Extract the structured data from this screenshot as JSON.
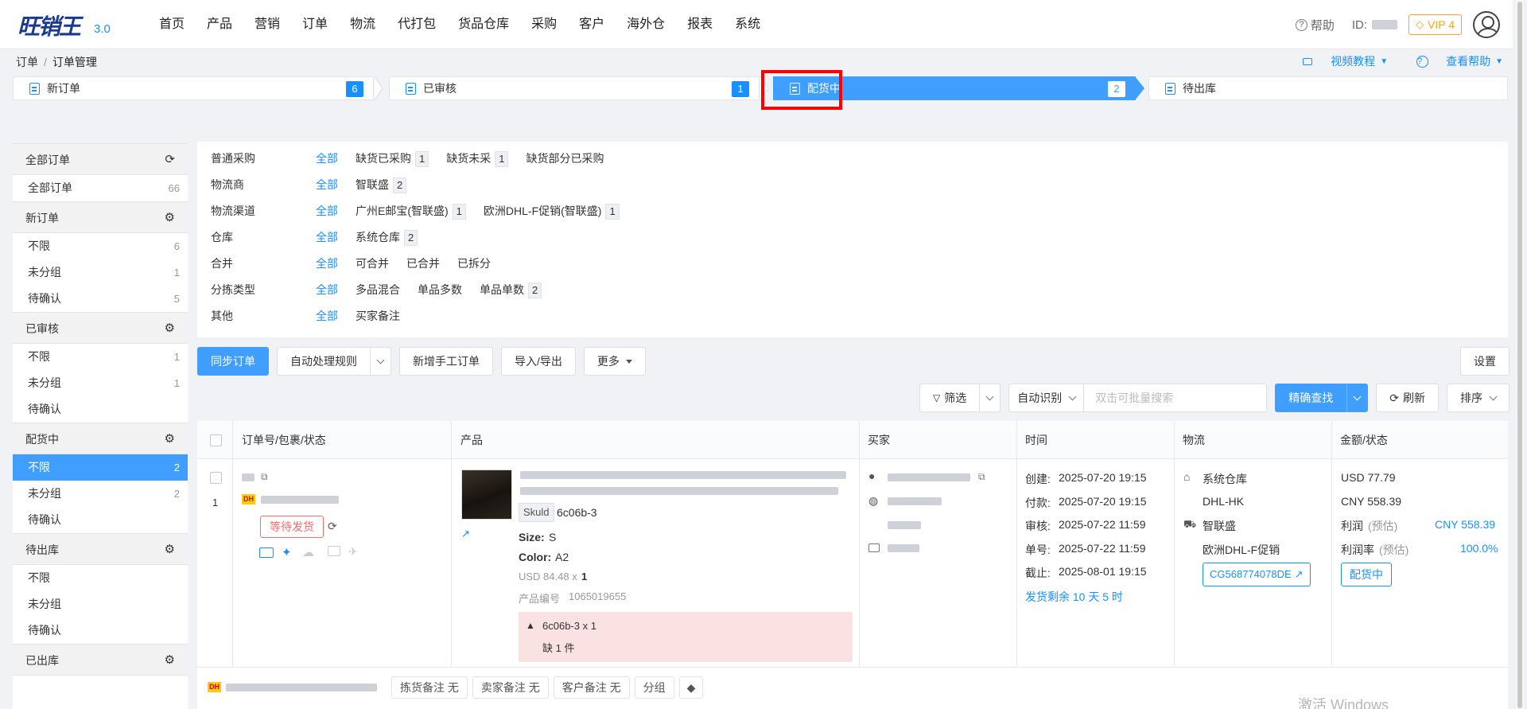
{
  "app": {
    "logo_text": "旺销王",
    "version": "3.0"
  },
  "nav": [
    "首页",
    "产品",
    "营销",
    "订单",
    "物流",
    "代打包",
    "货品仓库",
    "采购",
    "客户",
    "海外仓",
    "报表",
    "系统"
  ],
  "topright": {
    "help": "帮助",
    "id_label": "ID:",
    "vip": "VIP 4"
  },
  "breadcrumb": [
    "订单",
    "订单管理"
  ],
  "header_links": {
    "video": "视频教程",
    "help": "查看帮助"
  },
  "steps": [
    {
      "label": "新订单",
      "count": "6"
    },
    {
      "label": "已审核",
      "count": "1"
    },
    {
      "label": "配货中",
      "count": "2",
      "active": true
    },
    {
      "label": "待出库",
      "count": ""
    }
  ],
  "sidebar": [
    {
      "title": "全部订单",
      "icon": "refresh-icon",
      "items": [
        {
          "label": "全部订单",
          "count": "66"
        }
      ]
    },
    {
      "title": "新订单",
      "icon": "gear-icon",
      "items": [
        {
          "label": "不限",
          "count": "6"
        },
        {
          "label": "未分组",
          "count": "1"
        },
        {
          "label": "待确认",
          "count": "5"
        }
      ]
    },
    {
      "title": "已审核",
      "icon": "gear-icon",
      "items": [
        {
          "label": "不限",
          "count": "1"
        },
        {
          "label": "未分组",
          "count": "1"
        },
        {
          "label": "待确认",
          "count": ""
        }
      ]
    },
    {
      "title": "配货中",
      "icon": "gear-icon",
      "items": [
        {
          "label": "不限",
          "count": "2",
          "selected": true
        },
        {
          "label": "未分组",
          "count": "2"
        },
        {
          "label": "待确认",
          "count": ""
        }
      ]
    },
    {
      "title": "待出库",
      "icon": "gear-icon",
      "items": [
        {
          "label": "不限",
          "count": ""
        },
        {
          "label": "未分组",
          "count": ""
        },
        {
          "label": "待确认",
          "count": ""
        }
      ]
    },
    {
      "title": "已出库",
      "icon": "gear-icon",
      "items": []
    }
  ],
  "filters": [
    {
      "label": "普通采购",
      "all": "全部",
      "options": [
        {
          "text": "缺货已采购",
          "count": "1"
        },
        {
          "text": "缺货未采",
          "count": "1"
        },
        {
          "text": "缺货部分已采购",
          "count": ""
        }
      ]
    },
    {
      "label": "物流商",
      "all": "全部",
      "options": [
        {
          "text": "智联盛",
          "count": "2"
        }
      ]
    },
    {
      "label": "物流渠道",
      "all": "全部",
      "options": [
        {
          "text": "广州E邮宝(智联盛)",
          "count": "1"
        },
        {
          "text": "欧洲DHL-F促销(智联盛)",
          "count": "1"
        }
      ]
    },
    {
      "label": "仓库",
      "all": "全部",
      "options": [
        {
          "text": "系统仓库",
          "count": "2"
        }
      ]
    },
    {
      "label": "合并",
      "all": "全部",
      "options": [
        {
          "text": "可合并",
          "count": ""
        },
        {
          "text": "已合并",
          "count": ""
        },
        {
          "text": "已拆分",
          "count": ""
        }
      ]
    },
    {
      "label": "分拣类型",
      "all": "全部",
      "options": [
        {
          "text": "多品混合",
          "count": ""
        },
        {
          "text": "单品多数",
          "count": ""
        },
        {
          "text": "单品单数",
          "count": "2"
        }
      ]
    },
    {
      "label": "其他",
      "all": "全部",
      "options": [
        {
          "text": "买家备注",
          "count": ""
        }
      ]
    }
  ],
  "toolbar": {
    "sync": "同步订单",
    "auto_rules": "自动处理规则",
    "new_manual": "新增手工订单",
    "import_export": "导入/导出",
    "more": "更多",
    "settings": "设置"
  },
  "search": {
    "filter": "筛选",
    "auto_detect": "自动识别",
    "placeholder": "双击可批量搜索",
    "precise": "精确查找",
    "refresh": "刷新",
    "sort": "排序"
  },
  "table": {
    "headers": [
      "订单号/包裹/状态",
      "产品",
      "买家",
      "时间",
      "物流",
      "金额/状态"
    ],
    "row": {
      "index": "1",
      "carrier_badge": "DH",
      "status_button": "等待发货",
      "sku_label": "Skuld",
      "sku": "6c06b-3",
      "size_label": "Size:",
      "size": "S",
      "color_label": "Color:",
      "color": "A2",
      "price": "USD 84.48 x",
      "qty": "1",
      "product_no_label": "产品编号",
      "product_no": "1065019655",
      "alert_line1": "6c06b-3 x 1",
      "alert_line2": "缺 1 件",
      "times": [
        {
          "label": "创建:",
          "value": "2025-07-20 19:15"
        },
        {
          "label": "付款:",
          "value": "2025-07-20 19:15"
        },
        {
          "label": "审核:",
          "value": "2025-07-22 11:59"
        },
        {
          "label": "单号:",
          "value": "2025-07-22 11:59"
        },
        {
          "label": "截止:",
          "value": "2025-08-01 19:15"
        }
      ],
      "ship_remaining": "发货剩余 10 天 5 时",
      "warehouse": "系统仓库",
      "route": "DHL-HK",
      "provider": "智联盛",
      "channel": "欧洲DHL-F促销",
      "tracking": "CG568774078DE",
      "amount_usd": "USD 77.79",
      "amount_cny": "CNY 558.39",
      "profit_label": "利润",
      "profit_est": "(预估)",
      "profit": "CNY 558.39",
      "margin_label": "利润率",
      "margin_est": "(预估)",
      "margin": "100.0%",
      "status": "配货中"
    },
    "footer_tags": [
      "拣货备注 无",
      "卖家备注 无",
      "客户备注 无",
      "分组"
    ]
  },
  "watermark": "激活 Windows",
  "colors": {
    "primary": "#409eff",
    "danger": "#f56c6c",
    "highlight": "#ff0000"
  }
}
